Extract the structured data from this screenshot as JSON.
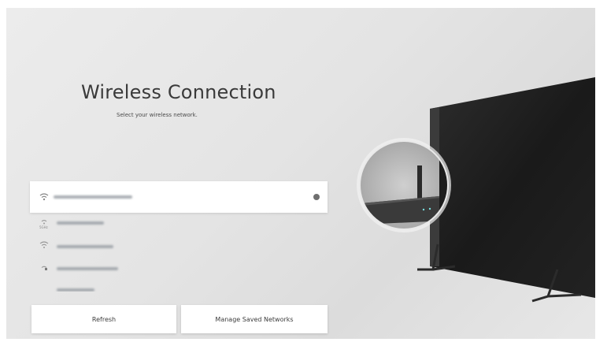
{
  "header": {
    "title": "Wireless Connection",
    "subtitle": "Select your wireless network."
  },
  "networks": [
    {
      "name": "xxxxxxxxx_5G",
      "selected": true,
      "signal_icon": "wifi-icon",
      "secured": true
    },
    {
      "name": "xxxxx_5G",
      "band": "5GHz",
      "signal_icon": "wifi-5ghz-icon"
    },
    {
      "name": "xxxxx_2G",
      "signal_icon": "wifi-icon"
    },
    {
      "name": "xxxxxx_2G",
      "signal_icon": "wifi-locked-icon"
    },
    {
      "name": "xxxxxx",
      "signal_icon": "wifi-icon"
    }
  ],
  "buttons": {
    "refresh": "Refresh",
    "manage": "Manage Saved Networks"
  },
  "colors": {
    "background": "#e6e6e6",
    "panel": "#ffffff",
    "text": "#3a3a3a"
  }
}
